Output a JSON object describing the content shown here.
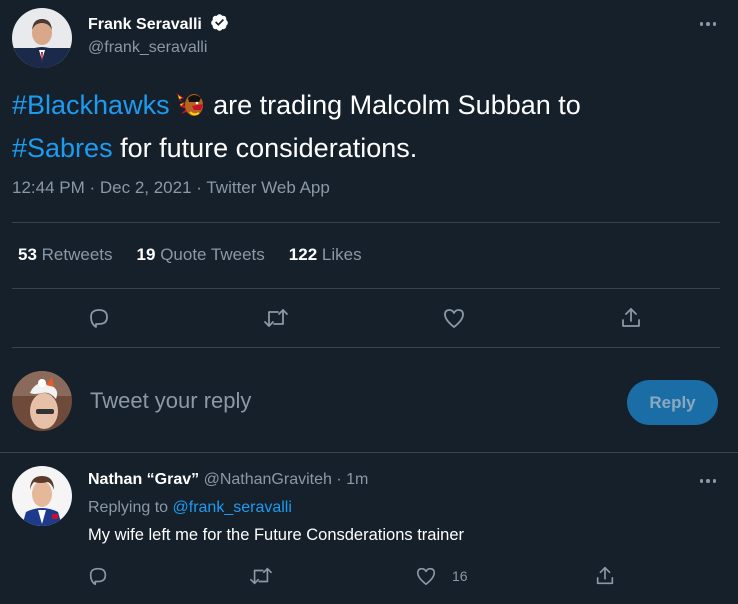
{
  "tweet": {
    "author_name": "Frank Seravalli",
    "author_handle": "@frank_seravalli",
    "text_parts": {
      "hashtag1": "#Blackhawks",
      "text1": " are trading Malcolm Subban to",
      "hashtag2": "#Sabres",
      "text2": " for future considerations."
    },
    "meta": "12:44 PM · Dec 2, 2021 · Twitter Web App",
    "stats": {
      "retweets_count": "53",
      "retweets_label": "Retweets",
      "quotes_count": "19",
      "quotes_label": "Quote Tweets",
      "likes_count": "122",
      "likes_label": "Likes"
    }
  },
  "composer": {
    "placeholder": "Tweet your reply",
    "reply_label": "Reply"
  },
  "reply": {
    "author_name": "Nathan “Grav”",
    "author_handle": "@NathanGraviteh",
    "time": "· 1m",
    "replying_prefix": "Replying to",
    "replying_to": "@frank_seravalli",
    "text": "My wife left me for the Future Consderations trainer",
    "like_count": "16"
  },
  "colors": {
    "background": "#15202b",
    "accent": "#1d9bf0",
    "secondary_text": "#8b98a5",
    "divider": "#38444d",
    "reply_button": "#1a6ea5"
  },
  "icons": [
    "verified-icon",
    "more-icon",
    "reply-icon",
    "retweet-icon",
    "like-icon",
    "share-icon",
    "blackhawks-emoji-icon"
  ]
}
